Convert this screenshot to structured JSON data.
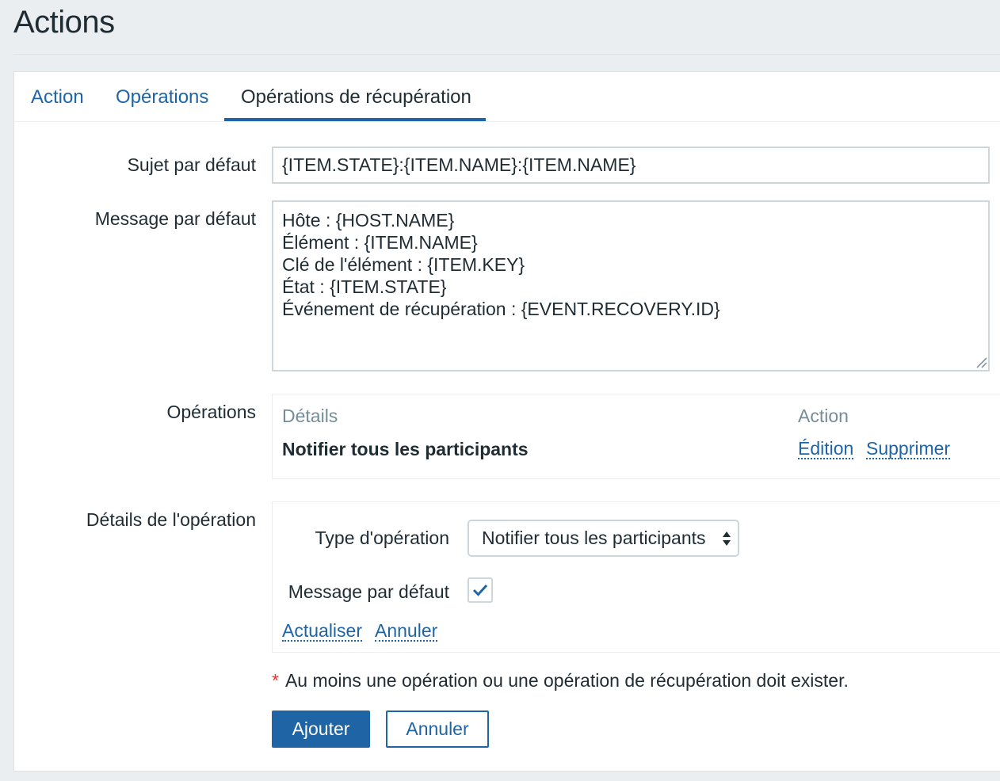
{
  "page": {
    "title": "Actions"
  },
  "tabs": [
    {
      "label": "Action",
      "active": false
    },
    {
      "label": "Opérations",
      "active": false
    },
    {
      "label": "Opérations de récupération",
      "active": true
    }
  ],
  "form": {
    "subject_label": "Sujet par défaut",
    "subject_value": "{ITEM.STATE}:{ITEM.NAME}:{ITEM.NAME}",
    "message_label": "Message par défaut",
    "message_value": "Hôte : {HOST.NAME}\nÉlément : {ITEM.NAME}\nClé de l'élément : {ITEM.KEY}\nÉtat : {ITEM.STATE}\nÉvénement de récupération : {EVENT.RECOVERY.ID}",
    "operations_label": "Opérations",
    "operation_details_label": "Détails de l'opération"
  },
  "operations_table": {
    "headers": {
      "details": "Détails",
      "action": "Action"
    },
    "rows": [
      {
        "details": "Notifier tous les participants",
        "edit": "Édition",
        "remove": "Supprimer"
      }
    ]
  },
  "operation_details": {
    "type_label": "Type d'opération",
    "type_value": "Notifier tous les participants",
    "default_message_label": "Message par défaut",
    "default_message_checked": true,
    "update_link": "Actualiser",
    "cancel_link": "Annuler"
  },
  "footer": {
    "required_star": "*",
    "hint": "Au moins une opération ou une opération de récupération doit exister.",
    "add_button": "Ajouter",
    "cancel_button": "Annuler"
  },
  "colors": {
    "accent": "#1f65a6",
    "text": "#1f2c33",
    "muted": "#768d99",
    "required": "#e33734"
  }
}
